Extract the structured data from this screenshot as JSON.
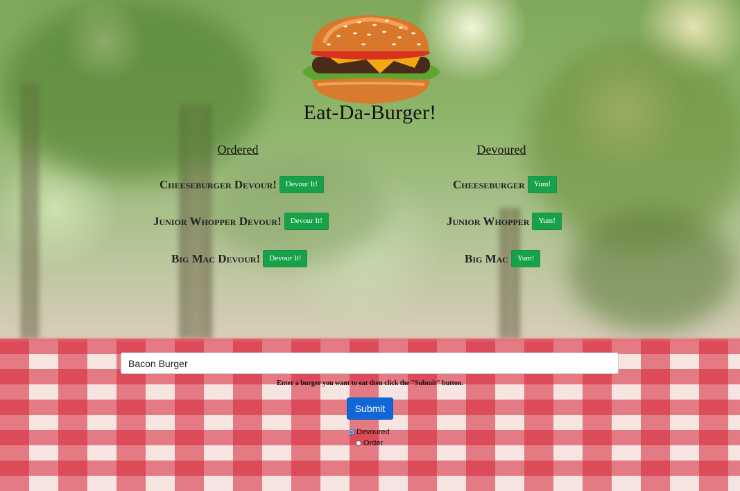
{
  "page": {
    "title": "Eat-Da-Burger!"
  },
  "columns": {
    "ordered_title": "Ordered",
    "devoured_title": "Devoured"
  },
  "ordered": [
    {
      "name": "Cheeseburger Devour!",
      "button": "Devour It!"
    },
    {
      "name": "Junior Whopper Devour!",
      "button": "Devour It!"
    },
    {
      "name": "Big Mac Devour!",
      "button": "Devour It!"
    }
  ],
  "devoured": [
    {
      "name": "Cheeseburger",
      "button": "Yum!"
    },
    {
      "name": "Junior Whopper",
      "button": "Yum!"
    },
    {
      "name": "Big Mac",
      "button": "Yum!"
    }
  ],
  "form": {
    "input_value": "Bacon Burger",
    "helper": "Enter a burger you want to eat then click the \"Submit\" button.",
    "submit_label": "Submit",
    "radios": [
      {
        "label": "Devoured",
        "checked": true
      },
      {
        "label": "Order",
        "checked": false
      }
    ]
  },
  "colors": {
    "button_green": "#17a24a",
    "submit_blue": "#1167d6",
    "tablecloth_red": "#d62438"
  }
}
